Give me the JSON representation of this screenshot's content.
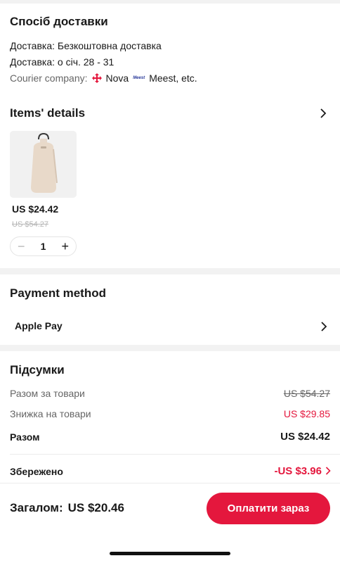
{
  "delivery": {
    "title": "Спосіб доставки",
    "method": "Доставка: Безкоштовна доставка",
    "dates": "Доставка: о січ. 28 - 31",
    "courier_label": "Courier company:",
    "courier_nova": "Nova",
    "courier_meest_logo": "Meest",
    "courier_rest": "Meest, etc."
  },
  "items": {
    "title": "Items' details",
    "list": [
      {
        "price": "US $24.42",
        "old_price": "US $54.27",
        "qty": "1"
      }
    ]
  },
  "payment": {
    "title": "Payment method",
    "method": "Apple Pay"
  },
  "summary": {
    "title": "Підсумки",
    "subtotal_label": "Разом за товари",
    "subtotal_value": "US $54.27",
    "discount_label": "Знижка на товари",
    "discount_value": "US $29.85",
    "total_label": "Разом",
    "total_value": "US $24.42",
    "saved_label": "Збережено",
    "saved_value": "-US $3.96"
  },
  "footer": {
    "grand_label": "Загалом:",
    "grand_value": "US $20.46",
    "pay_button": "Оплатити зараз"
  },
  "colors": {
    "accent": "#e4173d",
    "text": "#191919",
    "muted": "#666666",
    "separator": "#f2f2f2"
  },
  "icons": {
    "chevron": "chevron-right-icon",
    "minus": "minus-icon",
    "plus": "plus-icon",
    "nova_logo": "nova-poshta-logo-icon"
  }
}
